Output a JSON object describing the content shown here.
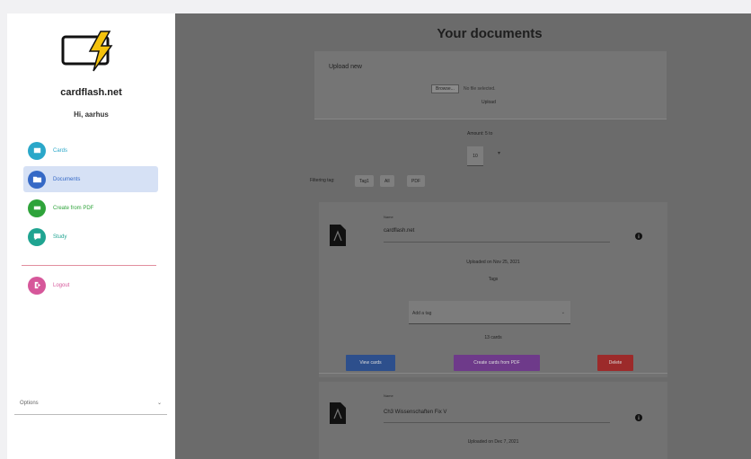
{
  "sidebar": {
    "brand": "cardflash.net",
    "greeting": "Hi, aarhus",
    "items": [
      {
        "label": "Cards",
        "icon": "card-icon",
        "color": "#2aa7c9",
        "active": false
      },
      {
        "label": "Documents",
        "icon": "folder-icon",
        "color": "#3569c6",
        "active": true
      },
      {
        "label": "Create from PDF",
        "icon": "add-pdf-icon",
        "color": "#2ea33a",
        "active": false
      },
      {
        "label": "Study",
        "icon": "study-icon",
        "color": "#1fa491",
        "active": false
      }
    ],
    "logout": {
      "label": "Logout",
      "icon": "logout-icon",
      "color": "#d6579a"
    },
    "options_label": "Options"
  },
  "main": {
    "title": "Your documents",
    "upload": {
      "title": "Upload new",
      "file_button": "Browse...",
      "file_text": "No file selected.",
      "submit": "Upload"
    },
    "per_page": {
      "label": "Amount: 5 to",
      "value": "10"
    },
    "filter": {
      "label": "Filtering tag:",
      "chips": [
        "Tag1",
        "All",
        "PDF"
      ]
    },
    "documents": [
      {
        "name_label": "Name",
        "name": "cardflash.net",
        "date": "Uploaded on Nov 25, 2021",
        "tags_label": "Tags",
        "tag_placeholder": "Add a tag",
        "cards": "13 cards",
        "view_label": "View cards",
        "create_label": "Create cards from PDF",
        "delete_label": "Delete"
      },
      {
        "name_label": "Name",
        "name": "Ch3 Wissenschaften Fix V",
        "date": "Uploaded on Dec 7, 2021"
      }
    ]
  },
  "colors": {
    "logo_yellow": "#f4c20d",
    "divider": "#e28f9f",
    "active_bg": "#d6e1f5"
  }
}
